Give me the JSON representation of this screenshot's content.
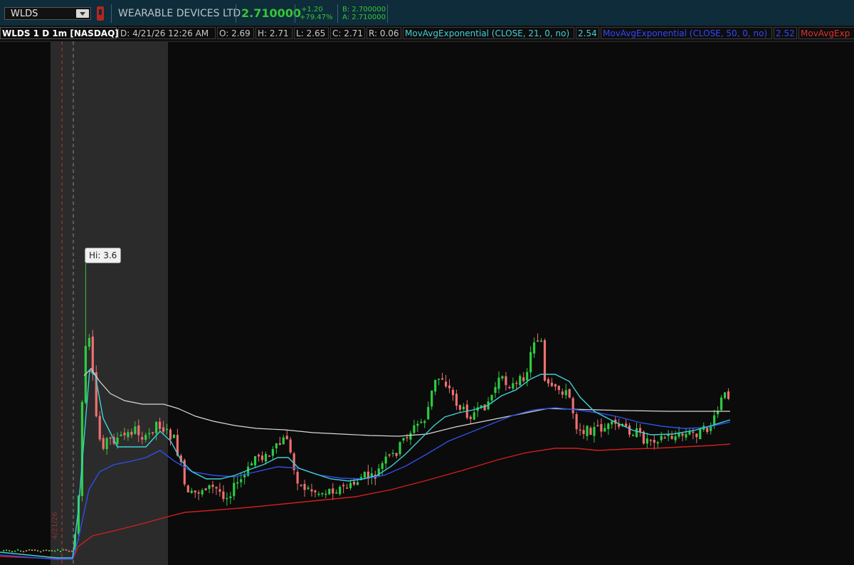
{
  "header": {
    "symbol": "WLDS",
    "company": "WEARABLE DEVICES LTD",
    "last": "2.710000",
    "net_change": "+1.20",
    "pct_change": "+79.47%",
    "bid": "B: 2.700000",
    "ask": "A: 2.710000"
  },
  "study_bar": {
    "title": "WLDS 1 D 1m [NASDAQ]",
    "date": "D: 4/21/26 12:26 AM",
    "open": "O: 2.69",
    "high": "H: 2.71",
    "low": "L: 2.65",
    "close": "C: 2.71",
    "range": "R: 0.06",
    "ema21_label": "MovAvgExponential (CLOSE, 21, 0, no)",
    "ema21_value": "2.54",
    "ema50_label": "MovAvgExponential (CLOSE, 50, 0, no)",
    "ema50_value": "2.52",
    "ema3_label": "MovAvgExp"
  },
  "colors": {
    "up_candle": "#2ecc40",
    "down_candle": "#f07070",
    "ema21": "#3fd0d8",
    "ema50": "#2f4fe8",
    "ema_slow": "#d21e1e",
    "vwap": "#d8d8d8",
    "premarket_shade": "#2b2b2b"
  },
  "chart_data": {
    "type": "candlestick",
    "annotation": "Hi: 3.6",
    "session_marker_label": "4/21/26",
    "series": [
      {
        "name": "MovAvgExponential (CLOSE, 21, 0, no)",
        "last": 2.54
      },
      {
        "name": "MovAvgExponential (CLOSE, 50, 0, no)",
        "last": 2.52
      }
    ],
    "ohlc_latest": {
      "open": 2.69,
      "high": 2.71,
      "low": 2.65,
      "close": 2.71
    },
    "key_points": {
      "high": 3.6,
      "last": 2.71
    }
  }
}
